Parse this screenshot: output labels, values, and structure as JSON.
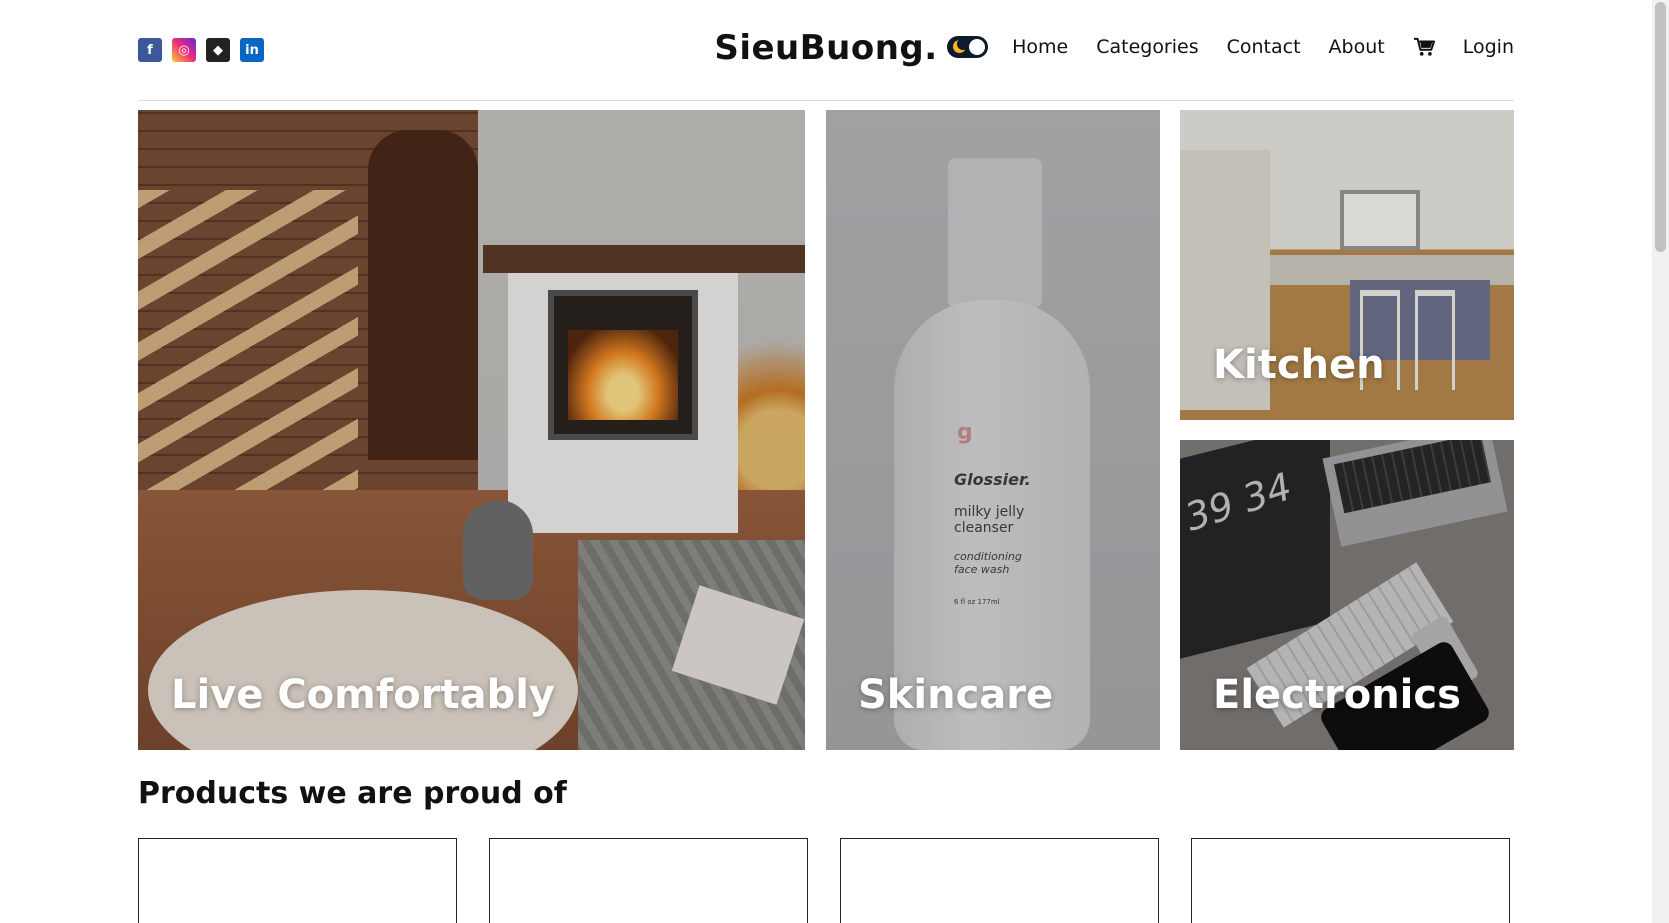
{
  "header": {
    "logo": "SieuBuong.",
    "socials": [
      {
        "icon": "facebook-icon",
        "glyph": "f"
      },
      {
        "icon": "instagram-icon",
        "glyph": "◎"
      },
      {
        "icon": "github-icon",
        "glyph": "◆"
      },
      {
        "icon": "linkedin-icon",
        "glyph": "in"
      }
    ],
    "nav": {
      "home": "Home",
      "categories": "Categories",
      "contact": "Contact",
      "about": "About",
      "login": "Login"
    },
    "theme_toggle": {
      "state": "dark",
      "icon": "moon-icon"
    },
    "cart_icon": "cart-icon"
  },
  "hero": {
    "tiles": [
      {
        "label": "Live Comfortably"
      },
      {
        "label": "Skincare"
      },
      {
        "label": "Kitchen"
      },
      {
        "label": "Electronics"
      }
    ],
    "skincare_product": {
      "brand": "Glossier.",
      "name": "milky jelly cleanser",
      "tagline": "conditioning face wash",
      "size": "6 fl oz   177ml"
    },
    "electronics_clock": "39 34"
  },
  "products": {
    "title": "Products we are proud of",
    "cards": [
      {},
      {},
      {},
      {}
    ]
  },
  "colors": {
    "facebook": "#3b5998",
    "linkedin": "#0a66c2",
    "toggle_bg": "#0f1b2d",
    "moon": "#f3b61f"
  }
}
